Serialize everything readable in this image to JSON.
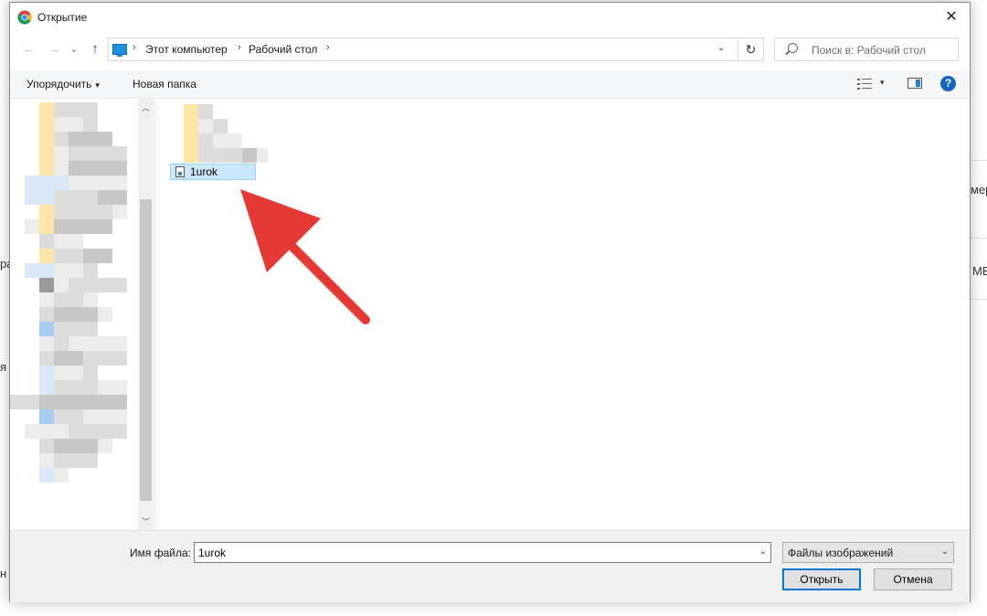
{
  "dialog": {
    "title": "Открытие",
    "close_glyph": "✕"
  },
  "navigation": {
    "back_glyph": "←",
    "forward_glyph": "→",
    "recent_glyph": "⌄",
    "up_glyph": "↑",
    "refresh_glyph": "↻"
  },
  "address": {
    "crumbs": [
      "Этот компьютер",
      "Рабочий стол"
    ],
    "separator": "›",
    "dropdown_glyph": "⌄"
  },
  "search": {
    "placeholder": "Поиск в: Рабочий стол"
  },
  "toolbar": {
    "organize_label": "Упорядочить",
    "organize_caret": "▾",
    "new_folder_label": "Новая папка",
    "view_caret": "▾",
    "help_glyph": "?"
  },
  "navpane": {
    "scroll_up_glyph": "︿",
    "scroll_down_glyph": "﹀"
  },
  "content": {
    "selected_file": "1urok"
  },
  "footer": {
    "filename_label": "Имя файла:",
    "filename_value": "1urok",
    "filename_dropdown_glyph": "⌄",
    "filter_value": "Файлы изображений",
    "filter_dropdown_glyph": "⌄",
    "open_label": "Открыть",
    "cancel_label": "Отмена"
  },
  "background": {
    "fragments": [
      "мер",
      "МЕ",
      "ра",
      "я",
      "н"
    ]
  },
  "colors": {
    "accent": "#0078d7",
    "selection": "#cce8ff",
    "annotation_arrow": "#e53935"
  }
}
